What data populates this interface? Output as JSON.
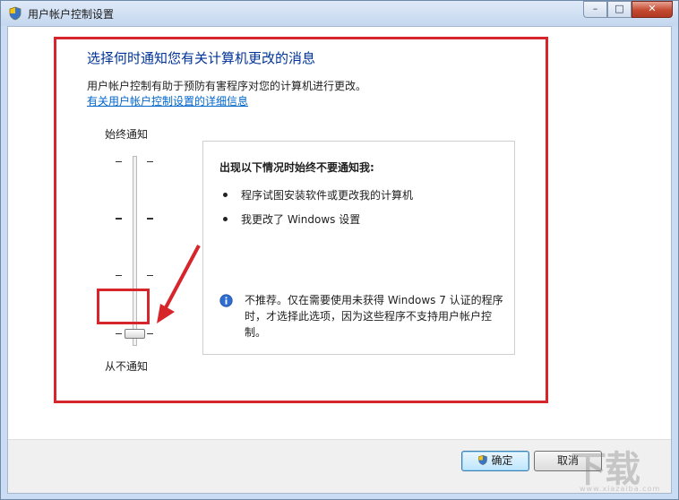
{
  "window": {
    "title": "用户帐户控制设置",
    "controls": {
      "minimize": "–",
      "maximize": "□",
      "close": "✕"
    }
  },
  "main": {
    "heading": "选择何时通知您有关计算机更改的消息",
    "description": "用户帐户控制有助于预防有害程序对您的计算机进行更改。",
    "link": "有关用户帐户控制设置的详细信息"
  },
  "slider": {
    "top_label": "始终通知",
    "bottom_label": "从不通知",
    "level_index": 0,
    "level_count": 4
  },
  "panel": {
    "title": "出现以下情况时始终不要通知我:",
    "bullets": [
      "程序试图安装软件或更改我的计算机",
      "我更改了 Windows 设置"
    ],
    "info": "不推荐。仅在需要使用未获得 Windows 7 认证的程序时，才选择此选项，因为这些程序不支持用户帐户控制。"
  },
  "buttons": {
    "ok": "确定",
    "cancel": "取消"
  },
  "watermark": {
    "brand": "下载",
    "url": "www.xiazaiba.com"
  },
  "colors": {
    "annotation": "#d7262b",
    "heading": "#003399",
    "link": "#0066cc"
  },
  "icons": {
    "title": "uac-shield-icon",
    "info": "info-icon",
    "ok": "uac-shield-icon"
  }
}
